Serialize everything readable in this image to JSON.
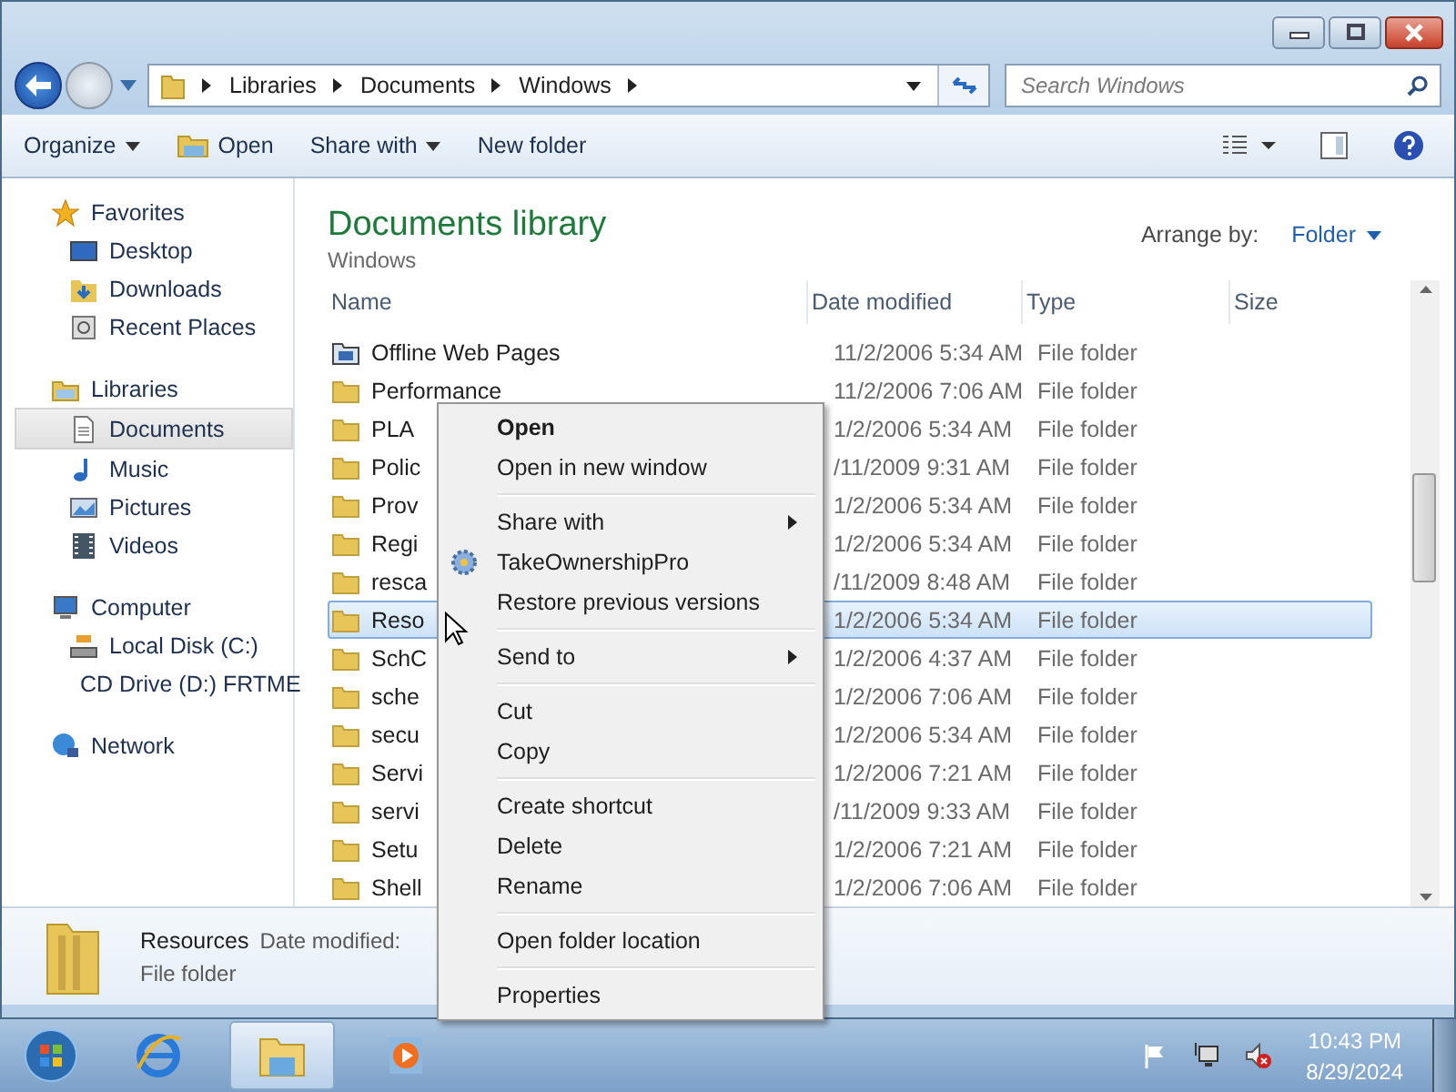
{
  "address_bar": {
    "crumbs": [
      "Libraries",
      "Documents",
      "Windows"
    ]
  },
  "search": {
    "placeholder": "Search Windows"
  },
  "toolbar": {
    "buttons": [
      {
        "label": "Organize",
        "kind": "dropdown"
      },
      {
        "label": "Open",
        "kind": "icon"
      },
      {
        "label": "Share with",
        "kind": "dropdown"
      },
      {
        "label": "New folder",
        "kind": "plain"
      }
    ]
  },
  "sidebar": {
    "groups": [
      {
        "label": "Favorites",
        "kind": "star",
        "children": [
          {
            "label": "Desktop",
            "kind": "desktop",
            "selected": false
          },
          {
            "label": "Downloads",
            "kind": "downloads",
            "selected": false
          },
          {
            "label": "Recent Places",
            "kind": "recent",
            "selected": false
          }
        ]
      },
      {
        "label": "Libraries",
        "kind": "library",
        "children": [
          {
            "label": "Documents",
            "kind": "document",
            "selected": true
          },
          {
            "label": "Music",
            "kind": "music",
            "selected": false
          },
          {
            "label": "Pictures",
            "kind": "pictures",
            "selected": false
          },
          {
            "label": "Videos",
            "kind": "videos",
            "selected": false
          }
        ]
      },
      {
        "label": "Computer",
        "kind": "computer",
        "children": [
          {
            "label": "Local Disk (C:)",
            "kind": "disk",
            "selected": false
          },
          {
            "label": "CD Drive (D:) FRTME",
            "kind": "cd",
            "selected": false
          }
        ]
      },
      {
        "label": "Network",
        "kind": "network"
      }
    ]
  },
  "library": {
    "title": "Documents library",
    "subtitle": "Windows",
    "arrange_label": "Arrange by:",
    "arrange_value": "Folder"
  },
  "table": {
    "columns": [
      "Name",
      "Date modified",
      "Type",
      "Size"
    ],
    "rows": [
      {
        "name": "Offline Web Pages",
        "date": "11/2/2006 5:34 AM",
        "type": "File folder",
        "kind": "special",
        "selected": false
      },
      {
        "name": "Performance",
        "date": "11/2/2006 7:06 AM",
        "type": "File folder",
        "kind": "folder",
        "selected": false
      },
      {
        "name": "PLA",
        "date": "1/2/2006 5:34 AM",
        "type": "File folder",
        "kind": "folder",
        "selected": false
      },
      {
        "name": "Polic",
        "date": "/11/2009 9:31 AM",
        "type": "File folder",
        "kind": "folder",
        "selected": false
      },
      {
        "name": "Prov",
        "date": "1/2/2006 5:34 AM",
        "type": "File folder",
        "kind": "folder",
        "selected": false
      },
      {
        "name": "Regi",
        "date": "1/2/2006 5:34 AM",
        "type": "File folder",
        "kind": "folder",
        "selected": false
      },
      {
        "name": "resca",
        "date": "/11/2009 8:48 AM",
        "type": "File folder",
        "kind": "folder",
        "selected": false
      },
      {
        "name": "Reso",
        "date": "1/2/2006 5:34 AM",
        "type": "File folder",
        "kind": "folder",
        "selected": true
      },
      {
        "name": "SchC",
        "date": "1/2/2006 4:37 AM",
        "type": "File folder",
        "kind": "folder",
        "selected": false
      },
      {
        "name": "sche",
        "date": "1/2/2006 7:06 AM",
        "type": "File folder",
        "kind": "folder",
        "selected": false
      },
      {
        "name": "secu",
        "date": "1/2/2006 5:34 AM",
        "type": "File folder",
        "kind": "folder",
        "selected": false
      },
      {
        "name": "Servi",
        "date": "1/2/2006 7:21 AM",
        "type": "File folder",
        "kind": "folder",
        "selected": false
      },
      {
        "name": "servi",
        "date": "/11/2009 9:33 AM",
        "type": "File folder",
        "kind": "folder",
        "selected": false
      },
      {
        "name": "Setu",
        "date": "1/2/2006 7:21 AM",
        "type": "File folder",
        "kind": "folder",
        "selected": false
      },
      {
        "name": "Shell",
        "date": "1/2/2006 7:06 AM",
        "type": "File folder",
        "kind": "folder",
        "selected": false
      }
    ]
  },
  "context_menu": {
    "groups": [
      [
        {
          "label": "Open",
          "default": true,
          "submenu": false,
          "kind": "plain"
        },
        {
          "label": "Open in new window",
          "default": false,
          "submenu": false,
          "kind": "plain"
        }
      ],
      [
        {
          "label": "Share with",
          "default": false,
          "submenu": true,
          "kind": "plain"
        },
        {
          "label": "TakeOwnershipPro",
          "default": false,
          "submenu": false,
          "kind": "icon"
        },
        {
          "label": "Restore previous versions",
          "default": false,
          "submenu": false,
          "kind": "plain"
        }
      ],
      [
        {
          "label": "Send to",
          "default": false,
          "submenu": true,
          "kind": "plain"
        }
      ],
      [
        {
          "label": "Cut",
          "default": false,
          "submenu": false,
          "kind": "plain"
        },
        {
          "label": "Copy",
          "default": false,
          "submenu": false,
          "kind": "plain"
        }
      ],
      [
        {
          "label": "Create shortcut",
          "default": false,
          "submenu": false,
          "kind": "plain"
        },
        {
          "label": "Delete",
          "default": false,
          "submenu": false,
          "kind": "plain"
        },
        {
          "label": "Rename",
          "default": false,
          "submenu": false,
          "kind": "plain"
        }
      ],
      [
        {
          "label": "Open folder location",
          "default": false,
          "submenu": false,
          "kind": "plain"
        }
      ],
      [
        {
          "label": "Properties",
          "default": false,
          "submenu": false,
          "kind": "plain"
        }
      ]
    ]
  },
  "details_pane": {
    "name": "Resources",
    "date_label": "Date modified:",
    "type": "File folder"
  },
  "taskbar": {
    "apps": [
      {
        "kind": "browser",
        "selected": false
      },
      {
        "kind": "explorer",
        "selected": true
      },
      {
        "kind": "media",
        "selected": false
      }
    ],
    "time": "10:43 PM",
    "date": "8/29/2024"
  }
}
